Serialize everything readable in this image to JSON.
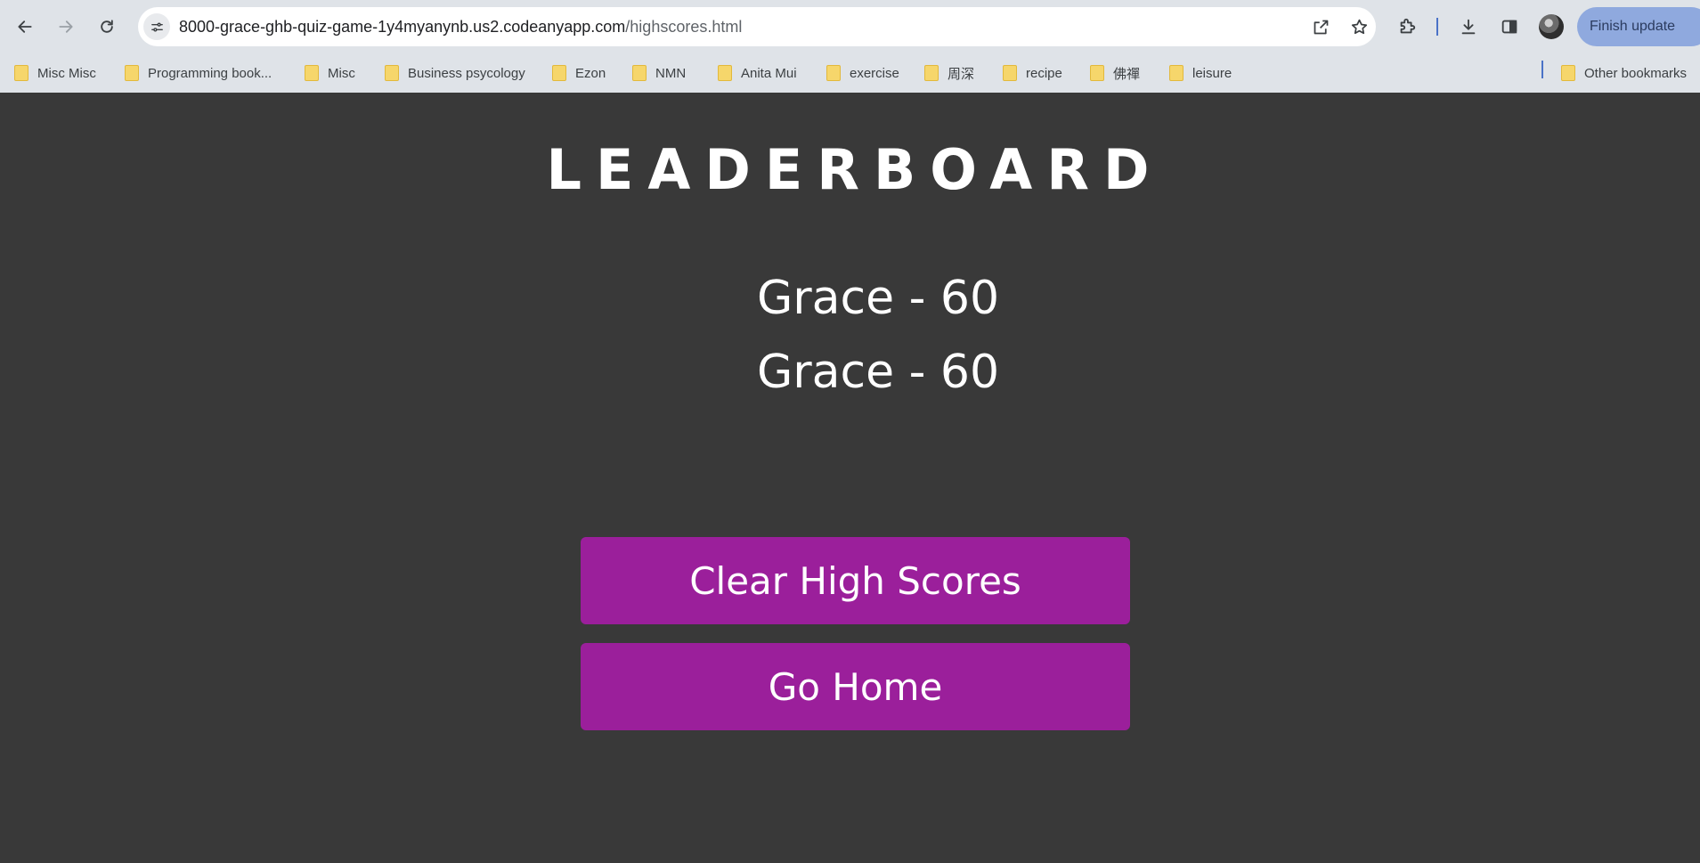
{
  "browser": {
    "url_host": "8000-grace-ghb-quiz-game-1y4myanynb.us2.codeanyapp.com",
    "url_path": "/highscores.html",
    "update_button": "Finish update",
    "bookmarks": [
      "Misc Misc",
      "Programming book...",
      "Misc",
      "Business psycology",
      "Ezon",
      "NMN",
      "Anita Mui",
      "exercise",
      "周深",
      "recipe",
      "佛禪",
      "leisure"
    ],
    "other_bookmarks": "Other bookmarks"
  },
  "page": {
    "title": "LEADERBOARD",
    "scores": [
      "Grace - 60",
      "Grace - 60"
    ],
    "clear_button": "Clear High Scores",
    "home_button": "Go Home"
  },
  "colors": {
    "background": "#393939",
    "button": "#9b1f9b"
  }
}
